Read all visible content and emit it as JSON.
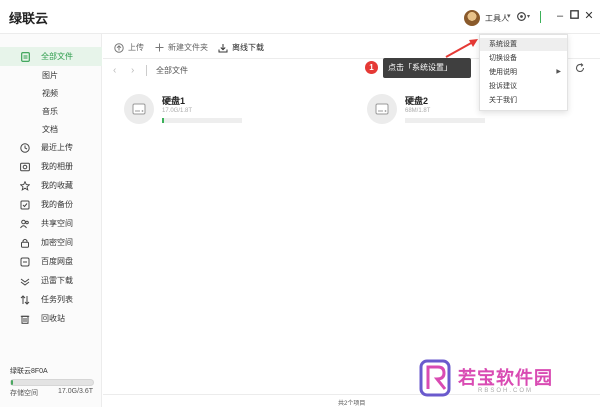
{
  "app": {
    "title": "绿联云",
    "user": "工具人"
  },
  "sidebar": {
    "items": [
      {
        "label": "全部文件",
        "icon": "file-icon",
        "active": true
      },
      {
        "label": "图片",
        "sub": true
      },
      {
        "label": "视频",
        "sub": true
      },
      {
        "label": "音乐",
        "sub": true
      },
      {
        "label": "文档",
        "sub": true
      },
      {
        "label": "最近上传",
        "icon": "clock-icon"
      },
      {
        "label": "我的相册",
        "icon": "album-icon"
      },
      {
        "label": "我的收藏",
        "icon": "star-icon"
      },
      {
        "label": "我的备份",
        "icon": "backup-icon"
      },
      {
        "label": "共享空间",
        "icon": "share-users-icon"
      },
      {
        "label": "加密空间",
        "icon": "lock-icon"
      },
      {
        "label": "百度网盘",
        "icon": "cloud-disk-icon"
      },
      {
        "label": "迅雷下载",
        "icon": "thunder-icon"
      },
      {
        "label": "任务列表",
        "icon": "transfer-icon"
      },
      {
        "label": "回收站",
        "icon": "trash-icon"
      }
    ],
    "device_name": "绿联云8F0A",
    "storage_label": "存储空间",
    "storage_value": "17.0G/3.6T",
    "storage_used_fraction": 0.005
  },
  "toolbar": {
    "upload": "上传",
    "new_folder": "新建文件夹",
    "offline_download": "离线下载"
  },
  "nav": {
    "breadcrumb": "全部文件"
  },
  "disks": [
    {
      "name": "硬盘1",
      "size": "17.0G/1.8T",
      "used_fraction": 0.01
    },
    {
      "name": "硬盘2",
      "size": "68M/1.8T",
      "used_fraction": 0.0
    }
  ],
  "status": {
    "text": "共2个项目"
  },
  "menu": {
    "items": [
      {
        "label": "系统设置",
        "hover": true
      },
      {
        "label": "切换设备"
      },
      {
        "label": "使用说明",
        "submenu": true
      },
      {
        "label": "投诉建议"
      },
      {
        "label": "关于我们"
      }
    ]
  },
  "callout": {
    "number": "1",
    "text": "点击「系统设置」"
  },
  "watermark": {
    "text": "若宝软件园",
    "sub": "RBSOH.COM"
  },
  "colors": {
    "accent": "#3cb15a",
    "active_bg": "#e7f4ea",
    "callout_red": "#e53935",
    "watermark": "#d94bb3"
  }
}
